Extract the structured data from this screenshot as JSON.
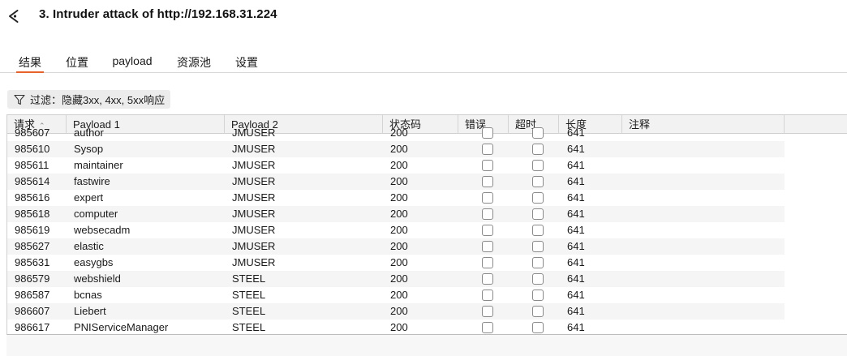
{
  "header": {
    "title": "3. Intruder attack of http://192.168.31.224",
    "back_icon": "back-arrow-icon"
  },
  "tabs": [
    {
      "label": "结果",
      "active": true
    },
    {
      "label": "位置",
      "active": false
    },
    {
      "label": "payload",
      "active": false
    },
    {
      "label": "资源池",
      "active": false
    },
    {
      "label": "设置",
      "active": false
    }
  ],
  "filter": {
    "icon": "filter-icon",
    "label": "过滤：隐藏3xx, 4xx, 5xx响应"
  },
  "table": {
    "sort_column": "请求",
    "sort_direction": "ascending",
    "columns": [
      "请求",
      "Payload 1",
      "Payload 2",
      "状态码",
      "错误",
      "超时",
      "长度",
      "注释"
    ],
    "rows": [
      {
        "request": "985607",
        "payload1": "author",
        "payload2": "JMUSER",
        "status": "200",
        "error": false,
        "timeout": false,
        "length": "641",
        "comment": ""
      },
      {
        "request": "985610",
        "payload1": "Sysop",
        "payload2": "JMUSER",
        "status": "200",
        "error": false,
        "timeout": false,
        "length": "641",
        "comment": ""
      },
      {
        "request": "985611",
        "payload1": "maintainer",
        "payload2": "JMUSER",
        "status": "200",
        "error": false,
        "timeout": false,
        "length": "641",
        "comment": ""
      },
      {
        "request": "985614",
        "payload1": "fastwire",
        "payload2": "JMUSER",
        "status": "200",
        "error": false,
        "timeout": false,
        "length": "641",
        "comment": ""
      },
      {
        "request": "985616",
        "payload1": "expert",
        "payload2": "JMUSER",
        "status": "200",
        "error": false,
        "timeout": false,
        "length": "641",
        "comment": ""
      },
      {
        "request": "985618",
        "payload1": "computer",
        "payload2": "JMUSER",
        "status": "200",
        "error": false,
        "timeout": false,
        "length": "641",
        "comment": ""
      },
      {
        "request": "985619",
        "payload1": "websecadm",
        "payload2": "JMUSER",
        "status": "200",
        "error": false,
        "timeout": false,
        "length": "641",
        "comment": ""
      },
      {
        "request": "985627",
        "payload1": "elastic",
        "payload2": "JMUSER",
        "status": "200",
        "error": false,
        "timeout": false,
        "length": "641",
        "comment": ""
      },
      {
        "request": "985631",
        "payload1": "easygbs",
        "payload2": "JMUSER",
        "status": "200",
        "error": false,
        "timeout": false,
        "length": "641",
        "comment": ""
      },
      {
        "request": "986579",
        "payload1": "webshield",
        "payload2": "STEEL",
        "status": "200",
        "error": false,
        "timeout": false,
        "length": "641",
        "comment": ""
      },
      {
        "request": "986587",
        "payload1": "bcnas",
        "payload2": "STEEL",
        "status": "200",
        "error": false,
        "timeout": false,
        "length": "641",
        "comment": ""
      },
      {
        "request": "986607",
        "payload1": "Liebert",
        "payload2": "STEEL",
        "status": "200",
        "error": false,
        "timeout": false,
        "length": "641",
        "comment": ""
      },
      {
        "request": "986617",
        "payload1": "PNIServiceManager",
        "payload2": "STEEL",
        "status": "200",
        "error": false,
        "timeout": false,
        "length": "641",
        "comment": ""
      }
    ]
  },
  "colors": {
    "accent": "#e8632b",
    "header_bg": "#f2f2f2",
    "alt_row_bg": "#f5f5f5"
  }
}
